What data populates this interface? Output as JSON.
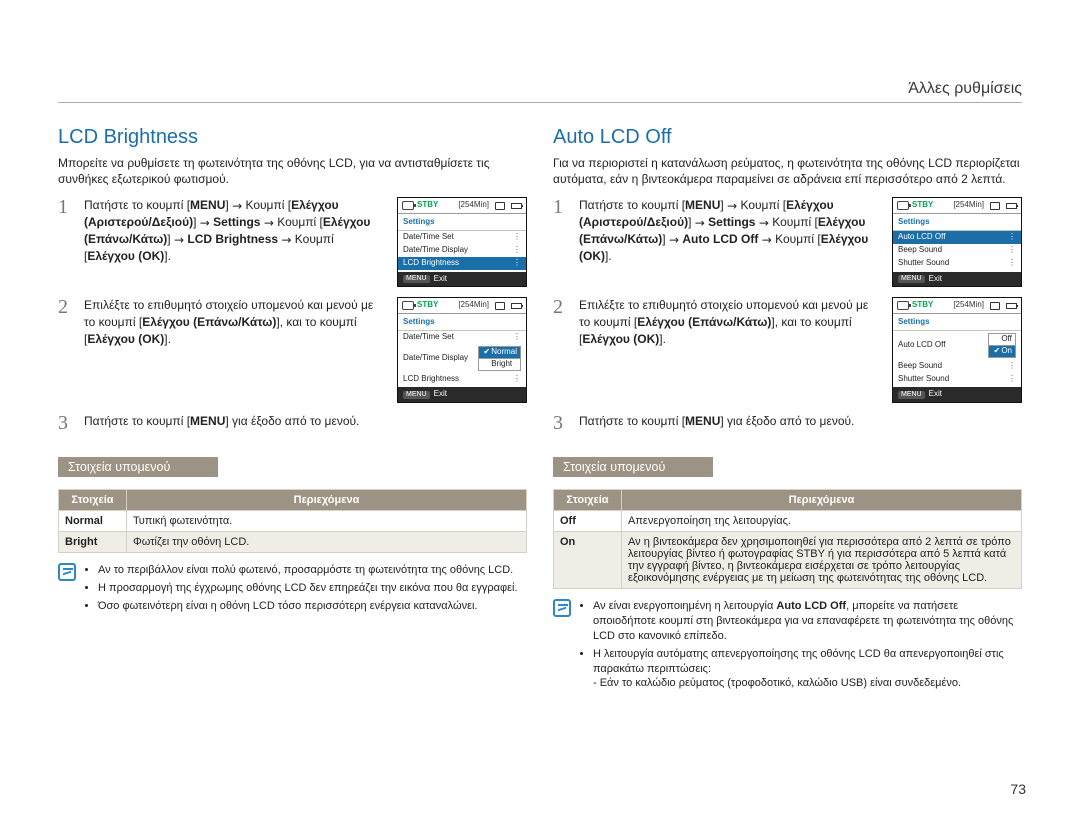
{
  "running_head": "Άλλες ρυθμίσεις",
  "page_number": "73",
  "arrow_glyph": "→",
  "left": {
    "title": "LCD Brightness",
    "intro": "Μπορείτε να ρυθμίσετε τη φωτεινότητα της οθόνης LCD, για να αντισταθμίσετε τις συνθήκες εξωτερικού φωτισμού.",
    "steps": [
      "Πατήστε το κουμπί [**MENU**] **→** Κουμπί [**Ελέγχου (Αριστερού/Δεξιού)**] **→** **Settings** **→** Κουμπί [**Ελέγχου (Επάνω/Κάτω)**] **→** **LCD Brightness** **→** Κουμπί [**Ελέγχου (OK)**].",
      "Επιλέξτε το επιθυμητό στοιχείο υπομενού και μενού με το κουμπί [**Ελέγχου (Επάνω/Κάτω)**], και το κουμπί [**Ελέγχου (OK)**].",
      "Πατήστε το κουμπί [**MENU**] για έξοδο από το μενού."
    ],
    "section_bar": "Στοιχεία υπομενού",
    "table": {
      "headers": [
        "Στοιχεία",
        "Περιεχόμενα"
      ],
      "rows": [
        {
          "key": "Normal",
          "val": "Τυπική φωτεινότητα."
        },
        {
          "key": "Bright",
          "val": "Φωτίζει την οθόνη LCD."
        }
      ]
    },
    "notes": [
      "Αν το περιβάλλον είναι πολύ φωτεινό, προσαρμόστε τη φωτεινότητα της οθόνης LCD.",
      "Η προσαρμογή της έγχρωμης οθόνης LCD δεν επηρεάζει την εικόνα που θα εγγραφεί.",
      "Όσο φωτεινότερη είναι η οθόνη LCD τόσο περισσότερη ενέργεια καταναλώνει."
    ],
    "screens": {
      "s1": {
        "stby": "STBY",
        "remain": "[254Min]",
        "title": "Settings",
        "rows": [
          {
            "label": "Date/Time Set",
            "mark": "⋮"
          },
          {
            "label": "Date/Time Display",
            "mark": "⋮",
            "marker_icon": "gear"
          },
          {
            "label": "LCD Brightness",
            "mark": "⋮",
            "sel": true
          }
        ],
        "exit": "Exit",
        "menu_chip": "MENU"
      },
      "s2": {
        "stby": "STBY",
        "remain": "[254Min]",
        "title": "Settings",
        "rows": [
          {
            "label": "Date/Time Set",
            "mark": "⋮"
          },
          {
            "label": "Date/Time Display",
            "submenu": true
          },
          {
            "label": "LCD Brightness",
            "mark": "⋮"
          }
        ],
        "submenu": [
          {
            "label": "Normal",
            "checked": true,
            "sel": true
          },
          {
            "label": "Bright"
          }
        ],
        "exit": "Exit",
        "menu_chip": "MENU"
      }
    }
  },
  "right": {
    "title": "Auto LCD Off",
    "intro": "Για να περιοριστεί η κατανάλωση ρεύματος, η φωτεινότητα της οθόνης LCD περιορίζεται αυτόματα, εάν η βιντεοκάμερα παραμείνει σε αδράνεια επί περισσότερο από 2 λεπτά.",
    "steps": [
      "Πατήστε το κουμπί [**MENU**] **→** Κουμπί [**Ελέγχου (Αριστερού/Δεξιού)**] **→** **Settings** **→** Κουμπί [**Ελέγχου (Επάνω/Κάτω)**] **→** **Auto LCD Off** **→** Κουμπί [**Ελέγχου (OK)**].",
      "Επιλέξτε το επιθυμητό στοιχείο υπομενού και μενού με το κουμπί [**Ελέγχου (Επάνω/Κάτω)**], και το κουμπί [**Ελέγχου (OK)**].",
      "Πατήστε το κουμπί [**MENU**] για έξοδο από το μενού."
    ],
    "section_bar": "Στοιχεία υπομενού",
    "table": {
      "headers": [
        "Στοιχεία",
        "Περιεχόμενα"
      ],
      "rows": [
        {
          "key": "Off",
          "val": "Απενεργοποίηση της λειτουργίας."
        },
        {
          "key": "On",
          "val": "Αν η βιντεοκάμερα δεν χρησιμοποιηθεί για περισσότερα από 2 λεπτά σε τρόπο λειτουργίας βίντεο ή φωτογραφίας STBY ή για περισσότερα από 5 λεπτά κατά την εγγραφή βίντεο, η βιντεοκάμερα εισέρχεται σε τρόπο λειτουργίας εξοικονόμησης ενέργειας με τη μείωση της φωτεινότητας της οθόνης LCD."
        }
      ]
    },
    "notes": [
      "Αν είναι ενεργοποιημένη η λειτουργία **Auto LCD Off**, μπορείτε να πατήσετε οποιοδήποτε κουμπί στη βιντεοκάμερα για να επαναφέρετε τη φωτεινότητα της οθόνης LCD στο κανονικό επίπεδο.",
      "Η λειτουργία αυτόματης απενεργοποίησης της οθόνης LCD θα απενεργοποιηθεί στις παρακάτω περιπτώσεις:\n- Εάν το καλώδιο ρεύματος (τροφοδοτικό, καλώδιο USB) είναι συνδεδεμένο."
    ],
    "screens": {
      "s1": {
        "stby": "STBY",
        "remain": "[254Min]",
        "title": "Settings",
        "rows": [
          {
            "label": "Auto LCD Off",
            "mark": "⋮",
            "sel": true
          },
          {
            "label": "Beep Sound",
            "mark": "⋮"
          },
          {
            "label": "Shutter Sound",
            "mark": "⋮"
          }
        ],
        "exit": "Exit",
        "menu_chip": "MENU"
      },
      "s2": {
        "stby": "STBY",
        "remain": "[254Min]",
        "title": "Settings",
        "rows": [
          {
            "label": "Auto LCD Off",
            "submenu": true
          },
          {
            "label": "Beep Sound",
            "mark": "⋮"
          },
          {
            "label": "Shutter Sound",
            "mark": "⋮"
          }
        ],
        "submenu": [
          {
            "label": "Off"
          },
          {
            "label": "On",
            "checked": true,
            "sel": true
          }
        ],
        "exit": "Exit",
        "menu_chip": "MENU"
      }
    }
  }
}
